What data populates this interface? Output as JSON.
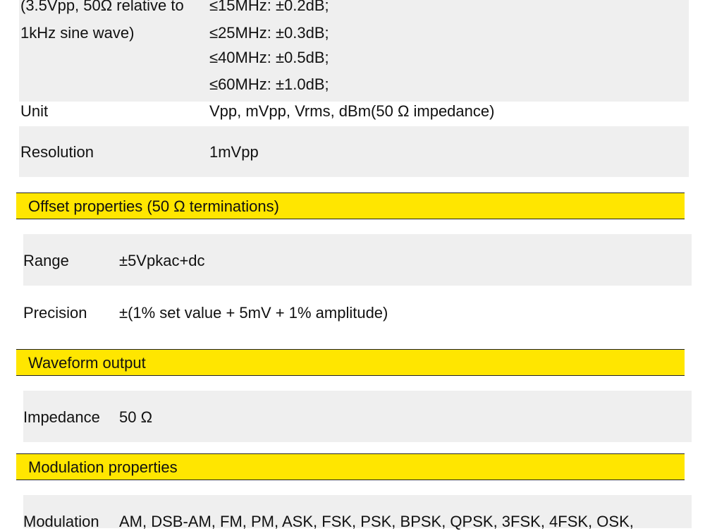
{
  "amplitude_flatness": {
    "label_line1": "(3.5Vpp, 50Ω relative to",
    "label_line2": "1kHz sine wave)",
    "values": [
      "≤15MHz: ±0.2dB;",
      "≤25MHz: ±0.3dB;",
      "≤40MHz: ±0.5dB;",
      "≤60MHz: ±1.0dB;"
    ]
  },
  "unit": {
    "label": "Unit",
    "value": "Vpp, mVpp, Vrms, dBm(50 Ω  impedance)"
  },
  "resolution": {
    "label": "Resolution",
    "value": "1mVpp"
  },
  "offset_section": {
    "title": "Offset properties (50 Ω  terminations)",
    "range": {
      "label": "Range",
      "value": "±5Vpkac+dc"
    },
    "precision": {
      "label": "Precision",
      "value": "±(1% set value + 5mV + 1% amplitude)"
    }
  },
  "waveform_section": {
    "title": "Waveform output",
    "impedance": {
      "label": "Impedance",
      "value": "50 Ω"
    }
  },
  "modulation_section": {
    "title": "Modulation properties",
    "modulation": {
      "label": "Modulation",
      "value": "AM, DSB-AM, FM, PM, ASK, FSK, PSK, BPSK, QPSK, 3FSK, 4FSK, OSK,"
    }
  }
}
